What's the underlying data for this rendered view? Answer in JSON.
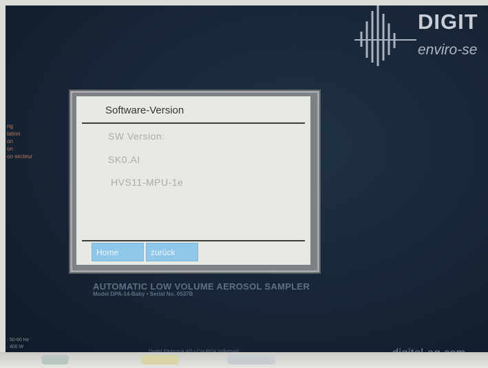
{
  "device": {
    "brand": "DIGIT",
    "tagline": "enviro-se",
    "side_labels": [
      "ng",
      "tation",
      "on",
      "on",
      "on secteur"
    ],
    "caption_line1": "AUTOMATIC LOW VOLUME AEROSOL SAMPLER",
    "caption_line2": "Model DPA-14-Baby • Serial No. 0537B",
    "power_lines": [
      ": 50-60 Hz",
      ": 400 W"
    ],
    "footer": "Digitel Elektronik AG • CH-8604 Volketswil",
    "website": "digitel-ag.com"
  },
  "screen": {
    "title": "Software-Version",
    "lines": [
      "SW Version:",
      "SK0.AI",
      "HVS11-MPU-1e"
    ],
    "buttons": {
      "home": "Home",
      "back": "zurück"
    }
  },
  "colors": {
    "panel": "#172536",
    "screen_bg": "#e7e9e3",
    "button": "#8fc7ea"
  }
}
